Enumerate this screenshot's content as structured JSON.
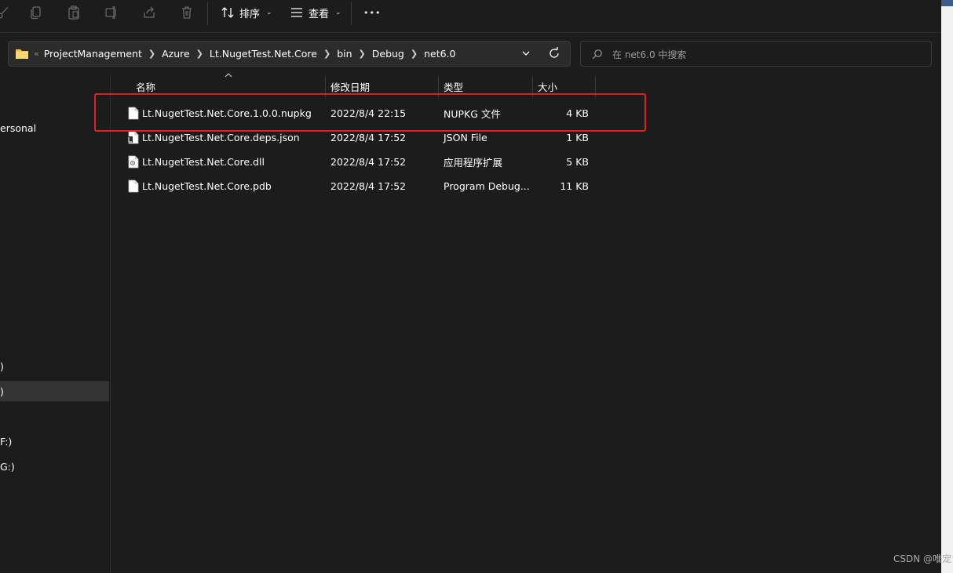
{
  "toolbar": {
    "sort_label": "排序",
    "view_label": "查看",
    "more_label": "•••"
  },
  "address": {
    "crumbs": [
      "ProjectManagement",
      "Azure",
      "Lt.NugetTest.Net.Core",
      "bin",
      "Debug",
      "net6.0"
    ]
  },
  "search": {
    "placeholder": "在 net6.0 中搜索"
  },
  "nav": {
    "items": [
      "ersonal",
      ")",
      ")",
      "F:)",
      "G:)"
    ],
    "selected_index": 2
  },
  "columns": {
    "name": "名称",
    "date": "修改日期",
    "type": "类型",
    "size": "大小"
  },
  "files": [
    {
      "name": "Lt.NugetTest.Net.Core.1.0.0.nupkg",
      "date": "2022/8/4 22:15",
      "type": "NUPKG 文件",
      "size": "4 KB",
      "icon": "file-icon"
    },
    {
      "name": "Lt.NugetTest.Net.Core.deps.json",
      "date": "2022/8/4 17:52",
      "type": "JSON File",
      "size": "1 KB",
      "icon": "json-file-icon"
    },
    {
      "name": "Lt.NugetTest.Net.Core.dll",
      "date": "2022/8/4 17:52",
      "type": "应用程序扩展",
      "size": "5 KB",
      "icon": "dll-file-icon"
    },
    {
      "name": "Lt.NugetTest.Net.Core.pdb",
      "date": "2022/8/4 17:52",
      "type": "Program Debug...",
      "size": "11 KB",
      "icon": "file-icon"
    }
  ],
  "watermark": "CSDN @唯宠",
  "colors": {
    "background": "#1c1c1c",
    "highlight_border": "#e02020",
    "folder": "#f4c542"
  }
}
